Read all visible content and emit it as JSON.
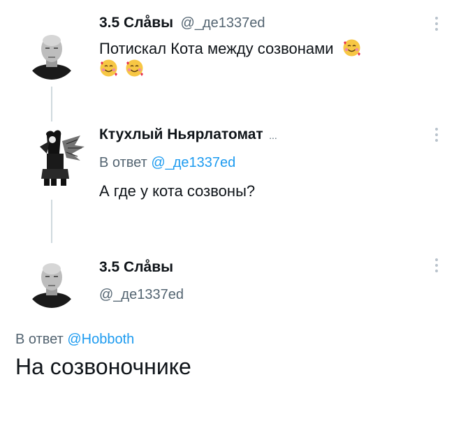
{
  "tweet1": {
    "author_name": "3.5 Слåвы",
    "author_handle": "@_де1337еd",
    "text": "Потискал Кота между созвонами",
    "emoji": "smiling-face-with-hearts",
    "emoji_count": 3
  },
  "tweet2": {
    "author_name": "Ктухлый Ньярлатомат",
    "name_ellipsis": "...",
    "reply_prefix": "В ответ",
    "reply_handle": "@_де1337еd",
    "text": "А где у кота созвоны?"
  },
  "tweet3": {
    "author_name": "3.5 Слåвы",
    "author_handle": "@_де1337еd",
    "reply_prefix": "В ответ",
    "reply_handle": "@Hobboth",
    "text": "На созвоночнике"
  },
  "colors": {
    "text": "#0f1419",
    "secondary": "#536471",
    "accent": "#1d9bf0",
    "thread_line": "#cfd9de"
  }
}
